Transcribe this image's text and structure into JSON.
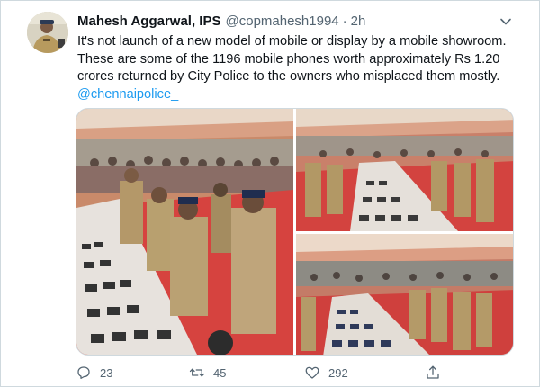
{
  "tweet": {
    "author_name": "Mahesh Aggarwal, IPS",
    "handle": "@copmahesh1994",
    "separator": "·",
    "time": "2h",
    "text_lines": [
      "It's not launch of a new model of mobile or display by a mobile showroom.",
      "These are some of the 1196 mobile phones worth approximately Rs 1.20",
      "crores returned by City Police to the owners who misplaced them mostly."
    ],
    "mention": "@chennaipolice_"
  },
  "actions": {
    "reply_count": "23",
    "retweet_count": "45",
    "like_count": "292"
  },
  "icons": {
    "reply": "reply-icon",
    "retweet": "retweet-icon",
    "like": "like-icon",
    "share": "share-icon",
    "more": "chevron-down-icon"
  },
  "colors": {
    "text": "#0f1419",
    "secondary": "#536471",
    "link": "#1d9bf0",
    "border": "#cfd9de"
  }
}
